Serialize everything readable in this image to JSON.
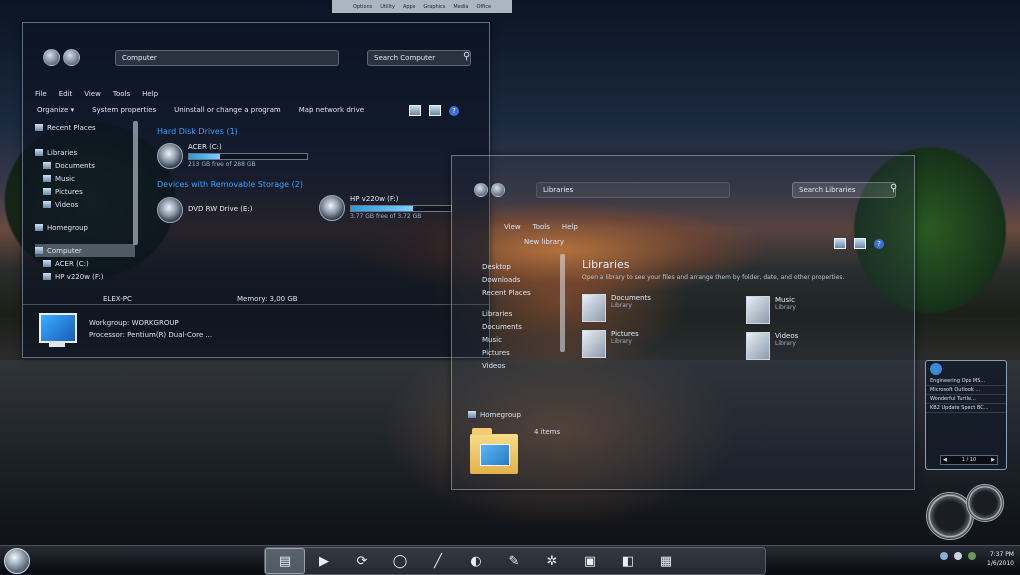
{
  "top_strip": {
    "items": [
      "Options",
      "Utility",
      "Apps",
      "Graphics",
      "Media",
      "Office"
    ]
  },
  "window1": {
    "address": "Computer",
    "search_placeholder": "Search Computer",
    "menu": [
      "File",
      "Edit",
      "View",
      "Tools",
      "Help"
    ],
    "toolbar": [
      "Organize ▾",
      "System properties",
      "Uninstall or change a program",
      "Map network drive"
    ],
    "nav": [
      {
        "label": "Recent Places",
        "icon": "recent-places-icon"
      },
      {
        "label": "Libraries",
        "icon": "library-icon"
      },
      {
        "label": "Documents",
        "icon": "documents-icon"
      },
      {
        "label": "Music",
        "icon": "music-icon"
      },
      {
        "label": "Pictures",
        "icon": "pictures-icon"
      },
      {
        "label": "Videos",
        "icon": "videos-icon"
      },
      {
        "label": "Homegroup",
        "icon": "homegroup-icon"
      },
      {
        "label": "Computer",
        "icon": "computer-icon"
      },
      {
        "label": "ACER (C:)",
        "icon": "drive-icon"
      },
      {
        "label": "HP v220w (F:)",
        "icon": "drive-icon"
      }
    ],
    "section_hdd": "Hard Disk Drives (1)",
    "section_removable": "Devices with Removable Storage (2)",
    "drives": [
      {
        "name": "ACER (C:)",
        "free": "213 GB free of 288 GB",
        "fill": 0.26
      },
      {
        "name": "DVD RW Drive (E:)",
        "free": "",
        "fill": null
      },
      {
        "name": "HP v220w (F:)",
        "free": "3.77 GB free of 3.72 GB",
        "fill": 0.62
      }
    ],
    "details": {
      "name": "ELEX-PC",
      "memory": "Memory: 3,00 GB",
      "workgroup": "Workgroup: WORKGROUP",
      "processor": "Processor: Pentium(R) Dual-Core ..."
    }
  },
  "window2": {
    "address": "Libraries",
    "search_placeholder": "Search Libraries",
    "menu": [
      "View",
      "Tools",
      "Help"
    ],
    "toolbar_new": "New library",
    "nav": [
      "Desktop",
      "Downloads",
      "Recent Places",
      "Libraries",
      "Documents",
      "Music",
      "Pictures",
      "Videos",
      "Homegroup"
    ],
    "title": "Libraries",
    "description": "Open a library to see your files and arrange them by folder, date, and other properties.",
    "libraries": [
      {
        "name": "Documents",
        "type": "Library"
      },
      {
        "name": "Music",
        "type": "Library"
      },
      {
        "name": "Pictures",
        "type": "Library"
      },
      {
        "name": "Videos",
        "type": "Library"
      }
    ],
    "status": "4 items"
  },
  "feed_gadget": {
    "rows": [
      "Engineering Ops MS...",
      "Microsoft Outlook ...",
      "Wonderful Turtle...",
      "KB2 Update Spect BC..."
    ],
    "pager": "1 / 10"
  },
  "taskbar": {
    "dock": [
      "▤",
      "▶",
      "⟳",
      "◯",
      "╱",
      "◐",
      "✎",
      "✲",
      "▣",
      "◧",
      "▦"
    ],
    "clock_time": "7:37 PM",
    "clock_date": "1/6/2010"
  }
}
